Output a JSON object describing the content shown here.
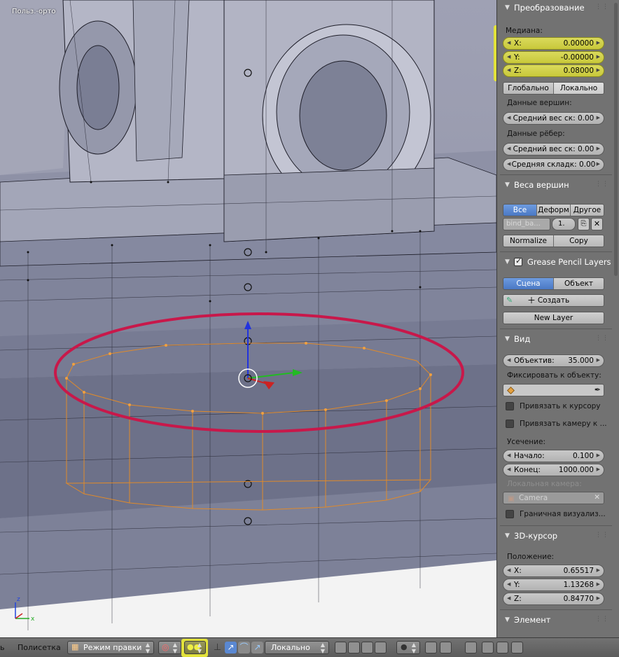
{
  "viewport": {
    "label": "Польз.-орто",
    "axis_z": "z",
    "axis_x": "x"
  },
  "panel": {
    "transform": {
      "title": "Преобразование",
      "median_label": "Медиана:",
      "x": {
        "label": "X:",
        "value": "0.00000"
      },
      "y": {
        "label": "Y:",
        "value": "-0.00000"
      },
      "z": {
        "label": "Z:",
        "value": "0.08000"
      },
      "global": "Глобально",
      "local": "Локально",
      "vertex_data": "Данные вершин:",
      "vertex_bevel": "Средний вес ск: 0.00",
      "edge_data": "Данные рёбер:",
      "edge_bevel": "Средний вес ск: 0.00",
      "edge_crease": "Средняя складк: 0.00"
    },
    "vertex_weights": {
      "title": "Веса вершин",
      "tabs": [
        "Все",
        "Деформ",
        "Другое"
      ],
      "group_name": "bind_ba...",
      "group_value": "1.",
      "normalize": "Normalize",
      "copy": "Copy"
    },
    "grease_pencil": {
      "title": "Grease Pencil Layers",
      "scene": "Сцена",
      "object": "Объект",
      "create": "Создать",
      "new_layer": "New Layer"
    },
    "view": {
      "title": "Вид",
      "lens": {
        "label": "Объектив:",
        "value": "35.000"
      },
      "lock_label": "Фиксировать к объекту:",
      "lock_cursor": "Привязать к курсору",
      "lock_camera": "Привязать камеру к ...",
      "clip_label": "Усечение:",
      "clip_start": {
        "label": "Начало:",
        "value": "0.100"
      },
      "clip_end": {
        "label": "Конец:",
        "value": "1000.000"
      },
      "local_camera_label": "Локальная камера:",
      "camera": "Camera",
      "bounds": "Граничная визуализ..."
    },
    "cursor": {
      "title": "3D-курсор",
      "position_label": "Положение:",
      "x": {
        "label": "X:",
        "value": "0.65517"
      },
      "y": {
        "label": "Y:",
        "value": "1.13268"
      },
      "z": {
        "label": "Z:",
        "value": "0.84770"
      }
    },
    "element": {
      "title": "Элемент"
    }
  },
  "header": {
    "menu_cut": "ь",
    "menu_mesh": "Полисетка",
    "mode": "Режим правки",
    "orientation": "Локально"
  },
  "colors": {
    "highlight": "#e2e23a",
    "selection_ring": "#c8184a",
    "active_tab": "#5a88d2"
  }
}
